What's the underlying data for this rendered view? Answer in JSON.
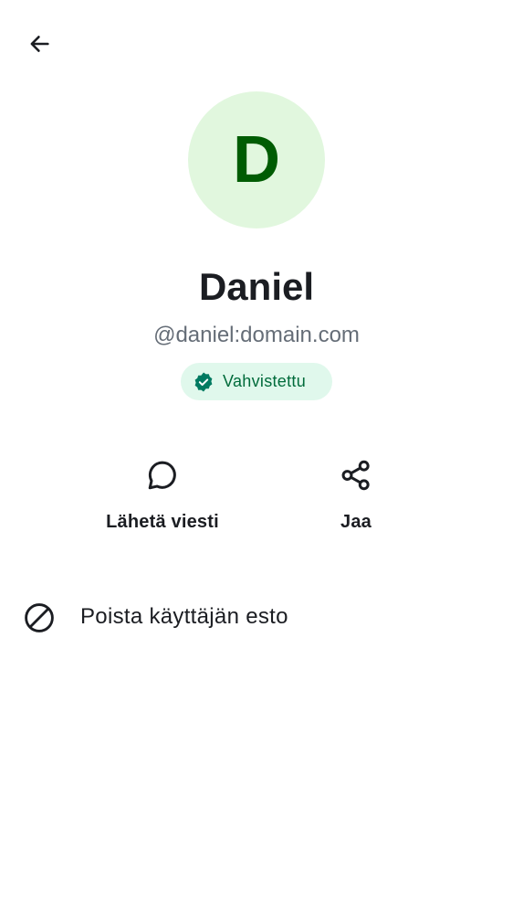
{
  "header": {
    "back_icon": "arrow-left-icon"
  },
  "profile": {
    "avatar_initial": "D",
    "avatar_bg": "#e1f7de",
    "avatar_fg": "#005c03",
    "display_name": "Daniel",
    "user_id": "@daniel:domain.com",
    "verified": {
      "icon": "verified-check-icon",
      "label": "Vahvistettu",
      "color": "#007a61"
    }
  },
  "actions": [
    {
      "icon": "chat-bubble-icon",
      "label": "Lähetä viesti"
    },
    {
      "icon": "share-icon",
      "label": "Jaa"
    }
  ],
  "list": [
    {
      "icon": "block-icon",
      "label": "Poista käyttäjän esto"
    }
  ]
}
